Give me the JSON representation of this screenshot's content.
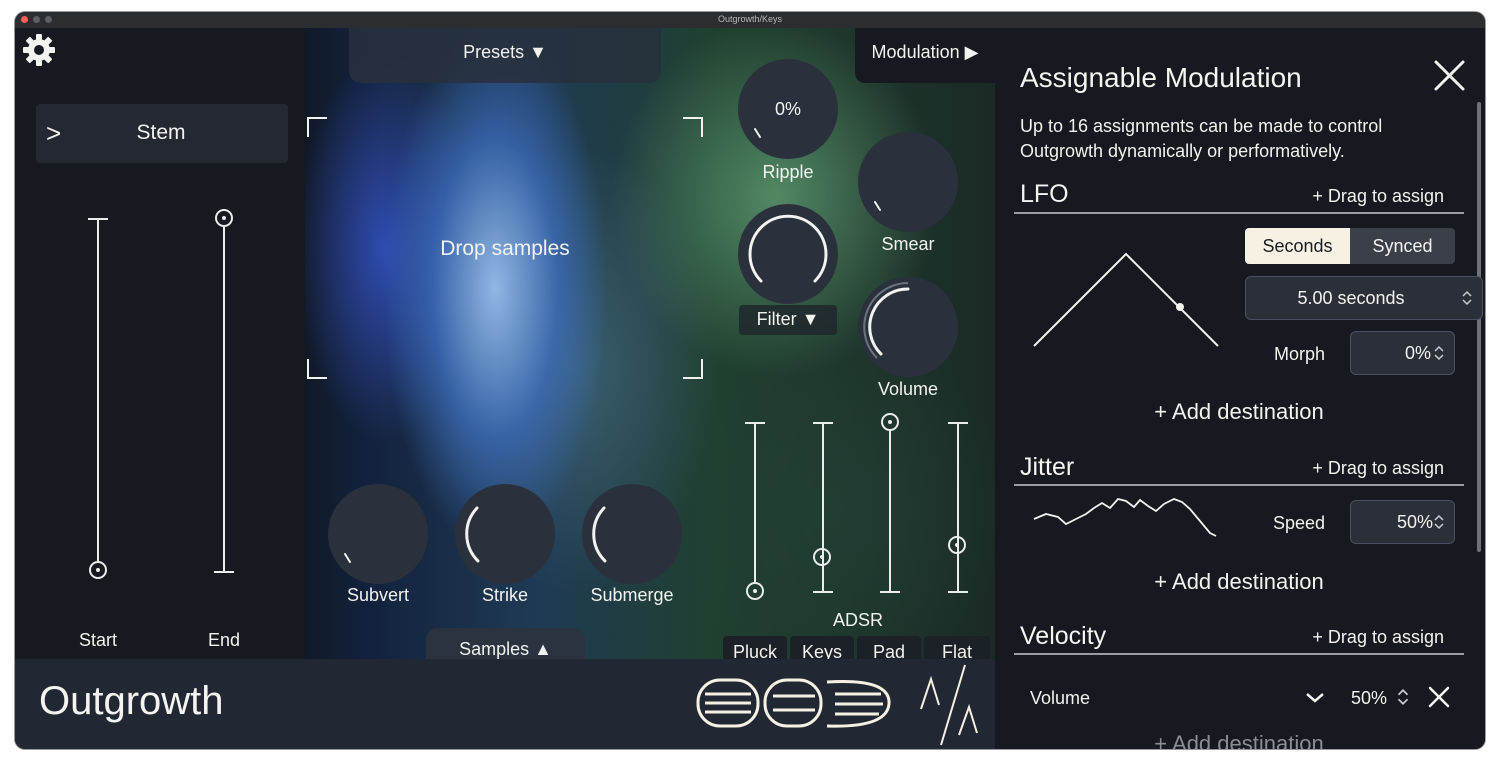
{
  "window": {
    "title": "Outgrowth/Keys"
  },
  "toolbar": {
    "presets_label": "Presets ▼",
    "modulation_label": "Modulation ▶",
    "samples_label": "Samples ▲"
  },
  "stem": {
    "arrow": ">",
    "label": "Stem"
  },
  "sample_range": {
    "start_label": "Start",
    "end_label": "End"
  },
  "drop_zone": {
    "label": "Drop samples"
  },
  "knobs": {
    "ripple": {
      "label": "Ripple",
      "value": "0%"
    },
    "smear": {
      "label": "Smear"
    },
    "filter": {
      "label": "Filter ▼"
    },
    "volume": {
      "label": "Volume"
    },
    "subvert": {
      "label": "Subvert"
    },
    "strike": {
      "label": "Strike"
    },
    "submerge": {
      "label": "Submerge"
    }
  },
  "adsr": {
    "label": "ADSR",
    "presets": [
      "Pluck",
      "Keys",
      "Pad",
      "Flat"
    ]
  },
  "brand": {
    "name": "Outgrowth"
  },
  "modulation_panel": {
    "title": "Assignable Modulation",
    "description_line1": "Up to 16 assignments can be made to control",
    "description_line2": "Outgrowth dynamically or performatively.",
    "drag_label": "+ Drag to assign",
    "add_destination": "+ Add destination",
    "lfo": {
      "title": "LFO",
      "mode_seconds": "Seconds",
      "mode_synced": "Synced",
      "rate_value": "5.00 seconds",
      "morph_label": "Morph",
      "morph_value": "0%"
    },
    "jitter": {
      "title": "Jitter",
      "speed_label": "Speed",
      "speed_value": "50%"
    },
    "velocity": {
      "title": "Velocity",
      "destination": "Volume",
      "amount": "50%"
    }
  },
  "icons": [
    "gear-icon",
    "close-icon",
    "chevron-right-icon",
    "chevron-down-icon",
    "stepper-icon",
    "remove-icon",
    "company-logo",
    "brand-mark-logo"
  ],
  "colors": {
    "panel": "#16191f",
    "knob": "#2a313c",
    "accent_selected": "#f6f1e2",
    "text": "#f2f2ee"
  }
}
